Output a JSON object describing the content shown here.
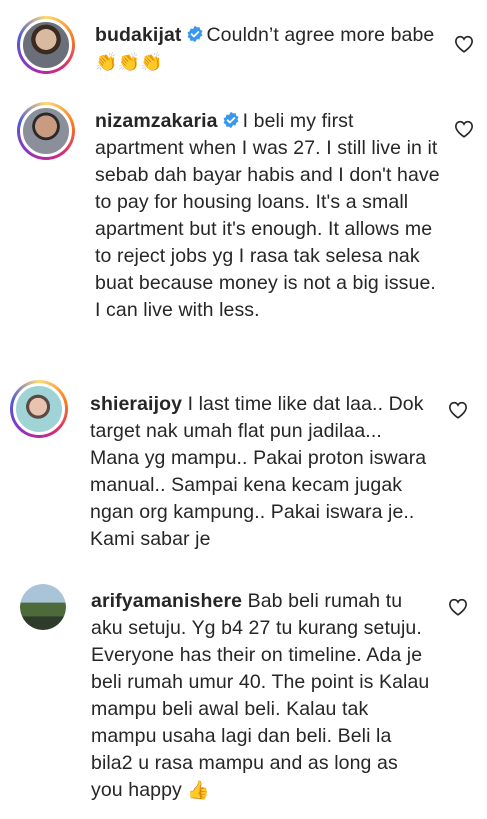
{
  "comments": [
    {
      "username": "budakijat",
      "verified": true,
      "text": "Couldn’t agree more babe",
      "emoji": "👏👏👏",
      "avatar_icon": "profile-photo-ring"
    },
    {
      "username": "nizamzakaria",
      "verified": true,
      "text": "I beli my first apartment when I was 27. I still live in it sebab dah bayar habis and I don't have to pay for housing loans. It's a small apartment but it's enough. It allows me to reject jobs yg I rasa tak selesa nak buat because money is not a big issue. I can live with less.",
      "avatar_icon": "profile-photo-ring"
    },
    {
      "username": "shieraijoy",
      "verified": false,
      "text": "I last time like dat laa.. Dok target nak umah flat pun jadilaa... Mana yg mampu.. Pakai proton iswara manual.. Sampai kena kecam jugak ngan org kampung.. Pakai iswara je.. Kami sabar je",
      "avatar_icon": "profile-photo-ring"
    },
    {
      "username": "arifyamanishere",
      "verified": false,
      "text": "Bab beli rumah tu aku setuju. Yg b4 27 tu kurang setuju. Everyone has their on timeline. Ada je beli rumah umur 40. The point is Kalau mampu beli awal beli. Kalau tak mampu usaha lagi dan beli. Beli la bila2 u rasa mampu and as long as you happy",
      "emoji": "👍",
      "avatar_icon": "profile-photo"
    }
  ],
  "colors": {
    "verified": "#3897f0",
    "text": "#262626",
    "heart_stroke": "#262626"
  }
}
